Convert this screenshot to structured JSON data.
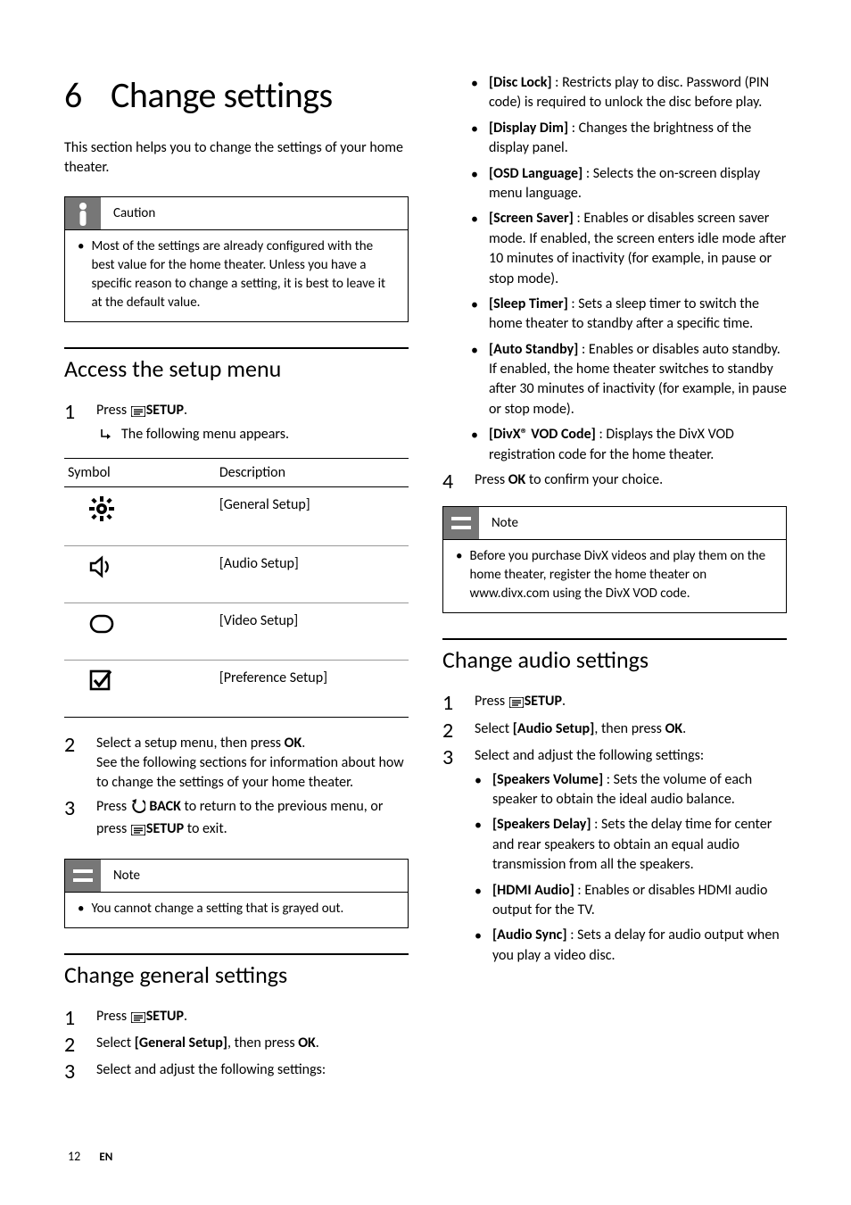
{
  "chapter_number": "6",
  "chapter_title": "Change settings",
  "intro": "This section helps you to change the settings of your home theater.",
  "caution": {
    "label": "Caution",
    "body": "Most of the settings are already configured with the best value for the home theater. Unless you have a specific reason to change a setting, it is best to leave it at the default value."
  },
  "section_access": {
    "title": "Access the setup menu",
    "step1_prefix": "Press ",
    "step1_label": "SETUP",
    "step1_suffix": ".",
    "step1_result": "The following menu appears.",
    "table": {
      "head_symbol": "Symbol",
      "head_desc": "Description",
      "rows": [
        {
          "desc": "[General Setup]"
        },
        {
          "desc": "[Audio Setup]"
        },
        {
          "desc": "[Video Setup]"
        },
        {
          "desc": "[Preference Setup]"
        }
      ]
    },
    "step2_a": "Select a setup menu, then press ",
    "step2_ok": "OK",
    "step2_b": ".",
    "step2_c": "See the following sections for information about how to change the settings of your home theater.",
    "step3_a": "Press ",
    "step3_back": " BACK",
    "step3_b": " to return to the previous menu, or press ",
    "step3_setup": "SETUP",
    "step3_c": " to exit.",
    "note": {
      "label": "Note",
      "body": "You cannot change a setting that is grayed out."
    }
  },
  "section_general": {
    "title": "Change general settings",
    "step1_a": "Press ",
    "step1_setup": "SETUP",
    "step1_b": ".",
    "step2_a": "Select ",
    "step2_opt": "[General Setup]",
    "step2_b": ", then press ",
    "step2_ok": "OK",
    "step2_c": ".",
    "step3": "Select and adjust the following settings:",
    "options": [
      {
        "name": "[Disc Lock]",
        "desc": " : Restricts play to disc. Password (PIN code) is required to unlock the disc before play."
      },
      {
        "name": "[Display Dim]",
        "desc": " : Changes the brightness of the display panel."
      },
      {
        "name": "[OSD Language]",
        "desc": " : Selects the on-screen display menu language."
      },
      {
        "name": "[Screen Saver]",
        "desc": " : Enables or disables screen saver mode. If enabled, the screen enters idle mode after 10 minutes of inactivity (for example, in pause or stop mode)."
      },
      {
        "name": "[Sleep Timer]",
        "desc": " : Sets a sleep timer to switch the home theater to standby after a specific time."
      },
      {
        "name": "[Auto Standby]",
        "desc": " : Enables or disables auto standby. If enabled, the home theater switches to standby after 30 minutes of inactivity (for example, in pause or stop mode)."
      },
      {
        "name": "[DivX® VOD Code]",
        "desc": " : Displays the DivX VOD registration code for the home theater."
      }
    ],
    "step4_a": "Press ",
    "step4_ok": "OK",
    "step4_b": " to confirm your choice.",
    "note": {
      "label": "Note",
      "body": "Before you purchase DivX videos and play them on the home theater, register the home theater on www.divx.com using the DivX VOD code."
    }
  },
  "section_audio": {
    "title": "Change audio settings",
    "step1_a": "Press ",
    "step1_setup": "SETUP",
    "step1_b": ".",
    "step2_a": "Select ",
    "step2_opt": "[Audio Setup]",
    "step2_b": ", then press ",
    "step2_ok": "OK",
    "step2_c": ".",
    "step3": "Select and adjust the following settings:",
    "options": [
      {
        "name": "[Speakers Volume]",
        "desc": " : Sets the volume of each speaker to obtain the ideal audio balance."
      },
      {
        "name": "[Speakers Delay]",
        "desc": " : Sets the delay time for center and rear speakers to obtain an equal audio transmission from all the speakers."
      },
      {
        "name": "[HDMI Audio]",
        "desc": " : Enables or disables HDMI audio output for the TV."
      },
      {
        "name": "[Audio Sync]",
        "desc": " : Sets a delay for audio output when you play a video disc."
      }
    ]
  },
  "footer": {
    "page": "12",
    "lang": "EN"
  }
}
